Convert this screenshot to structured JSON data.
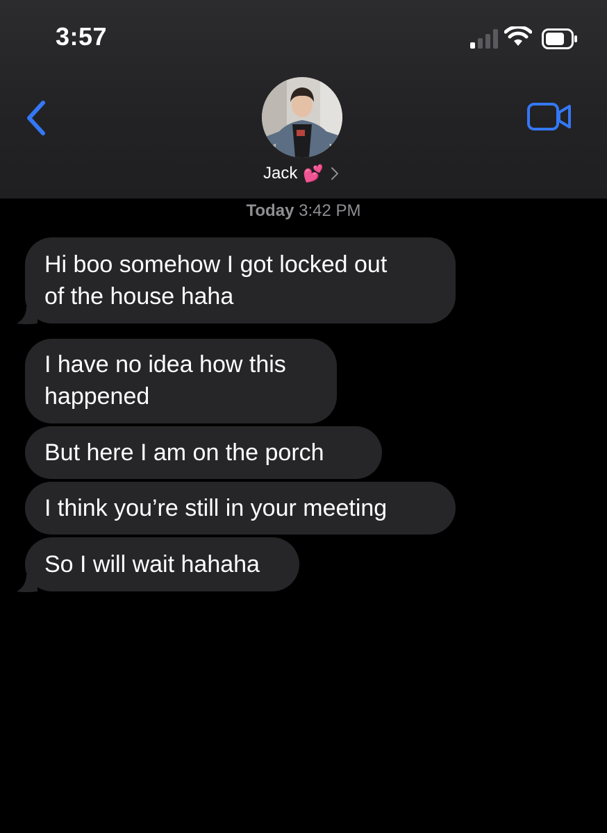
{
  "status_bar": {
    "time": "3:57",
    "signal_icon": "cellular-signal-icon",
    "wifi_icon": "wifi-icon",
    "battery_icon": "battery-icon"
  },
  "header": {
    "back_icon": "chevron-left-icon",
    "video_icon": "video-camera-icon",
    "contact_name": "Jack",
    "contact_emoji": "💕",
    "accent_color": "#3478f6"
  },
  "conversation": {
    "timestamp_day": "Today",
    "timestamp_time": "3:42 PM",
    "bubble_color": "#262628",
    "messages": [
      "Hi boo somehow I got locked out\nof the house haha",
      "I have no idea how this\nhappened",
      "But here I am on the porch",
      "I think you’re still in your meeting",
      "So I will wait hahaha"
    ]
  }
}
